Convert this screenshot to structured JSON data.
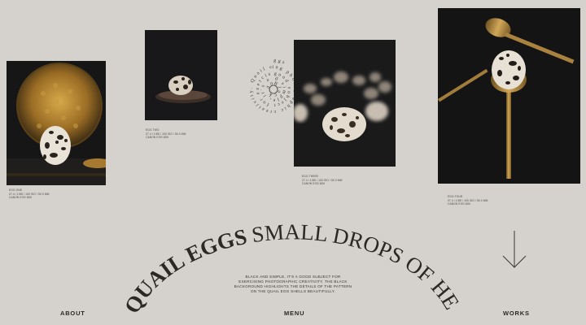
{
  "hero": {
    "title_bold": "QUAIL EGGS",
    "title_light": "SMALL DROPS OF HEAVEN"
  },
  "description": "Black and simple, it's a good subject for exercising photographic creativity. The black background highlights the details of the pattern on the quail egg shells beautifully.",
  "spiral_text": "Black and simple, it's a good subject for exercising photographic creativity. Quail eggs",
  "photos": [
    {
      "id": "egg-one",
      "caption_title": "Egg One",
      "caption_spec": "27.4 / 1/8s / 100 ISO / 50.0 mm",
      "caption_model": "Canon EOS 6DII"
    },
    {
      "id": "egg-two",
      "caption_title": "Egg Two",
      "caption_spec": "27.4 / 1/8s / 100 ISO / 50.0 mm",
      "caption_model": "Canon EOS 6DII"
    },
    {
      "id": "egg-three",
      "caption_title": "Egg Three",
      "caption_spec": "27.4 / 1/8s / 100 ISO / 50.0 mm",
      "caption_model": "Canon EOS 6DII"
    },
    {
      "id": "egg-four",
      "caption_title": "Egg Four",
      "caption_spec": "27.4 / 1/8s / 100 ISO / 50.0 mm",
      "caption_model": "Canon EOS 6DII"
    }
  ],
  "nav": {
    "about": "ABOUT",
    "menu": "MENU",
    "works": "WORKS"
  },
  "icons": {
    "scroll": "arrow-down-icon"
  },
  "colors": {
    "background": "#d5d1cc",
    "text": "#2b2826",
    "gold": "#b08a45",
    "photo_bg": "#1c1c1e"
  }
}
